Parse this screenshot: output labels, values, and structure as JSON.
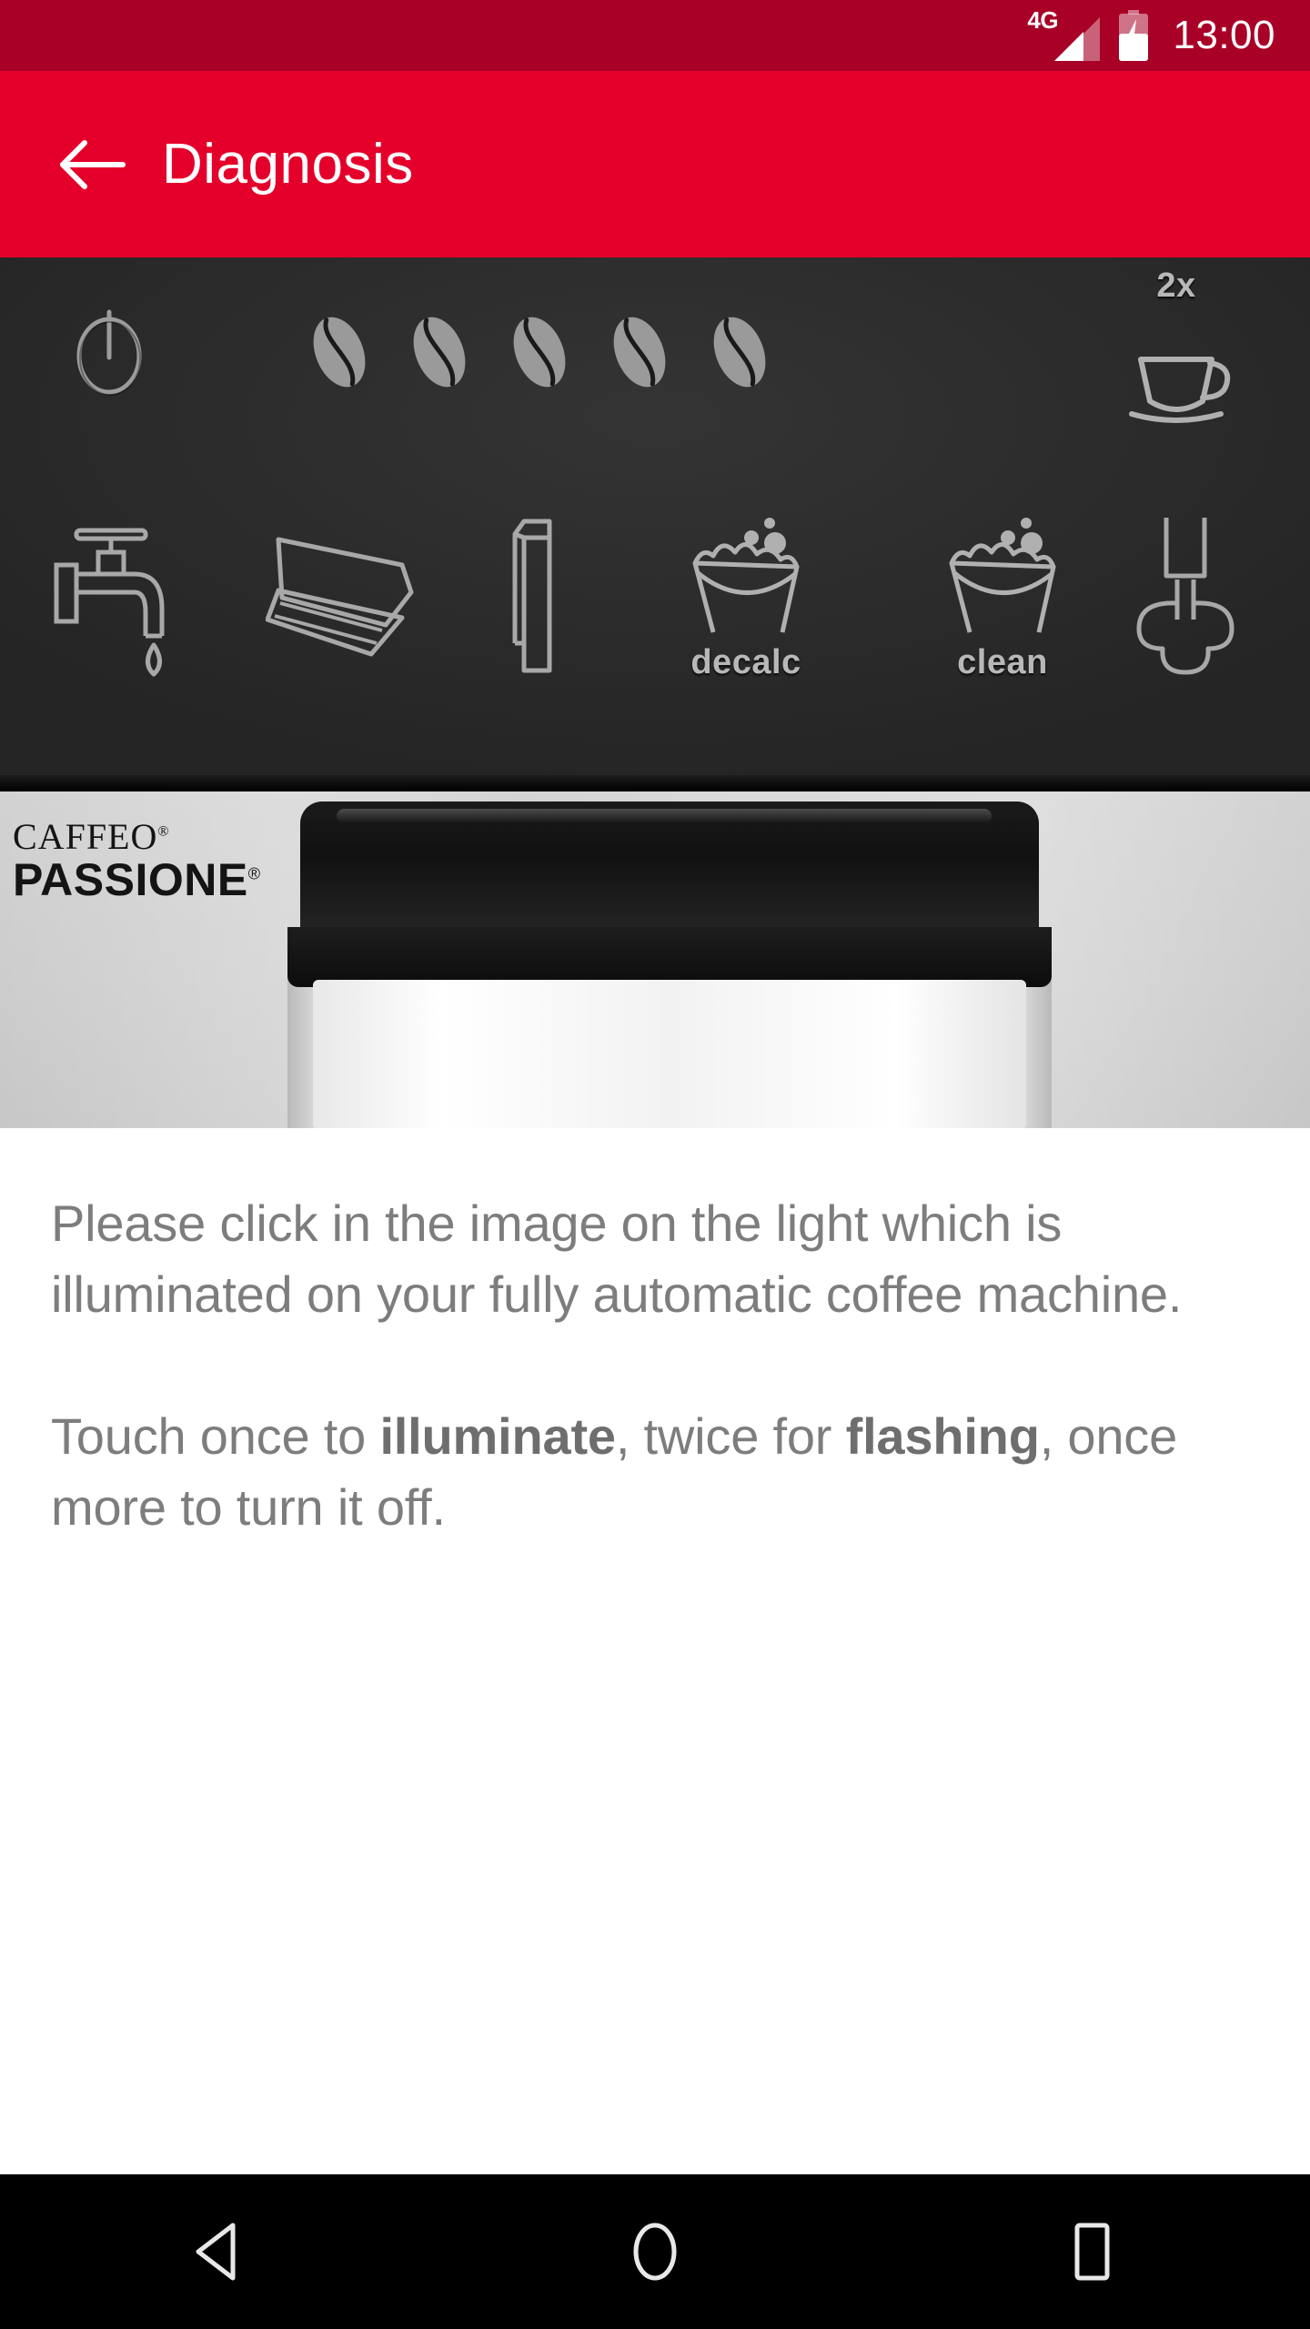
{
  "status_bar": {
    "network_label": "4G",
    "time": "13:00",
    "signal_icon": "signal-bars-icon",
    "battery_icon": "battery-charging-icon",
    "background_color": "#A80027",
    "foreground_color": "#FFFFFF"
  },
  "app_bar": {
    "title": "Diagnosis",
    "back_icon": "back-arrow-icon",
    "background_color": "#E4002B",
    "foreground_color": "#FFFFFF"
  },
  "machine_image": {
    "alt": "Melitta CAFFEO PASSIONE control panel",
    "panel_color": "#2E2E2E",
    "icon_color": "#B0B0B0",
    "brand_line_1": "CAFFEO",
    "brand_line_2": "PASSIONE",
    "registered_mark": "®",
    "controls_row_1": [
      {
        "name": "power-button-icon",
        "label": ""
      },
      {
        "name": "coffee-bean-1-icon",
        "label": ""
      },
      {
        "name": "coffee-bean-2-icon",
        "label": ""
      },
      {
        "name": "coffee-bean-3-icon",
        "label": ""
      },
      {
        "name": "coffee-bean-4-icon",
        "label": ""
      },
      {
        "name": "coffee-bean-5-icon",
        "label": ""
      },
      {
        "name": "double-cup-icon",
        "label": "2x"
      }
    ],
    "controls_row_2": [
      {
        "name": "water-tap-icon",
        "label": ""
      },
      {
        "name": "drip-tray-icon",
        "label": ""
      },
      {
        "name": "water-filter-icon",
        "label": ""
      },
      {
        "name": "descale-icon",
        "label": "decalc"
      },
      {
        "name": "clean-icon",
        "label": "clean"
      },
      {
        "name": "milk-frother-icon",
        "label": ""
      }
    ]
  },
  "instructions": {
    "paragraph_1": "Please click in the image on the light which is illuminated on your fully automatic coffee machine.",
    "paragraph_2_part_1": "Touch once to ",
    "paragraph_2_bold_1": "illuminate",
    "paragraph_2_part_2": ", twice for ",
    "paragraph_2_bold_2": "flashing",
    "paragraph_2_part_3": ", once more to turn it off.",
    "text_color": "#7D7D7D"
  },
  "nav_bar": {
    "back": "nav-back-icon",
    "home": "nav-home-icon",
    "recents": "nav-recents-icon",
    "background_color": "#000000"
  }
}
